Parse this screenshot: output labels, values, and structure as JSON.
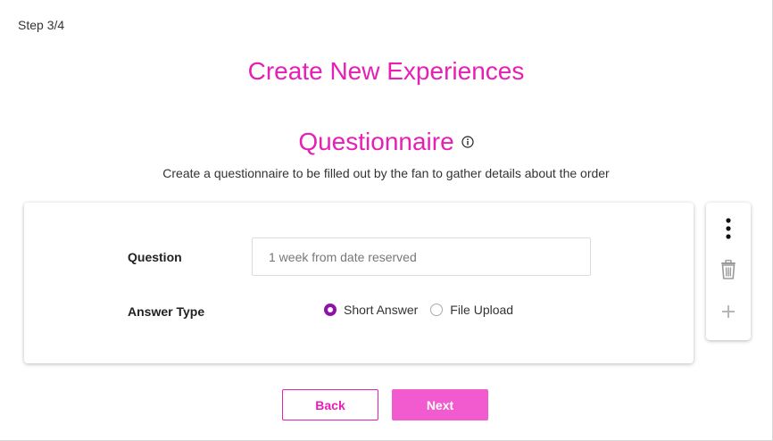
{
  "header": {
    "step": "Step 3/4",
    "title": "Create New Experiences"
  },
  "section": {
    "title": "Questionnaire",
    "info_icon": "info-icon",
    "subtitle": "Create a questionnaire to be filled out by the fan to gather details about the order"
  },
  "question_card": {
    "question_label": "Question",
    "question_value": "",
    "question_placeholder": "1 week from date reserved",
    "answer_type_label": "Answer Type",
    "answer_options": [
      {
        "label": "Short Answer",
        "selected": true
      },
      {
        "label": "File Upload",
        "selected": false
      }
    ]
  },
  "toolbar": {
    "items": [
      "more-vertical-icon",
      "trash-icon",
      "plus-icon"
    ]
  },
  "footer": {
    "back_label": "Back",
    "next_label": "Next"
  },
  "colors": {
    "accent": "#e61fb5",
    "next_button": "#f25bcf",
    "radio_selected": "#8e12a8"
  }
}
